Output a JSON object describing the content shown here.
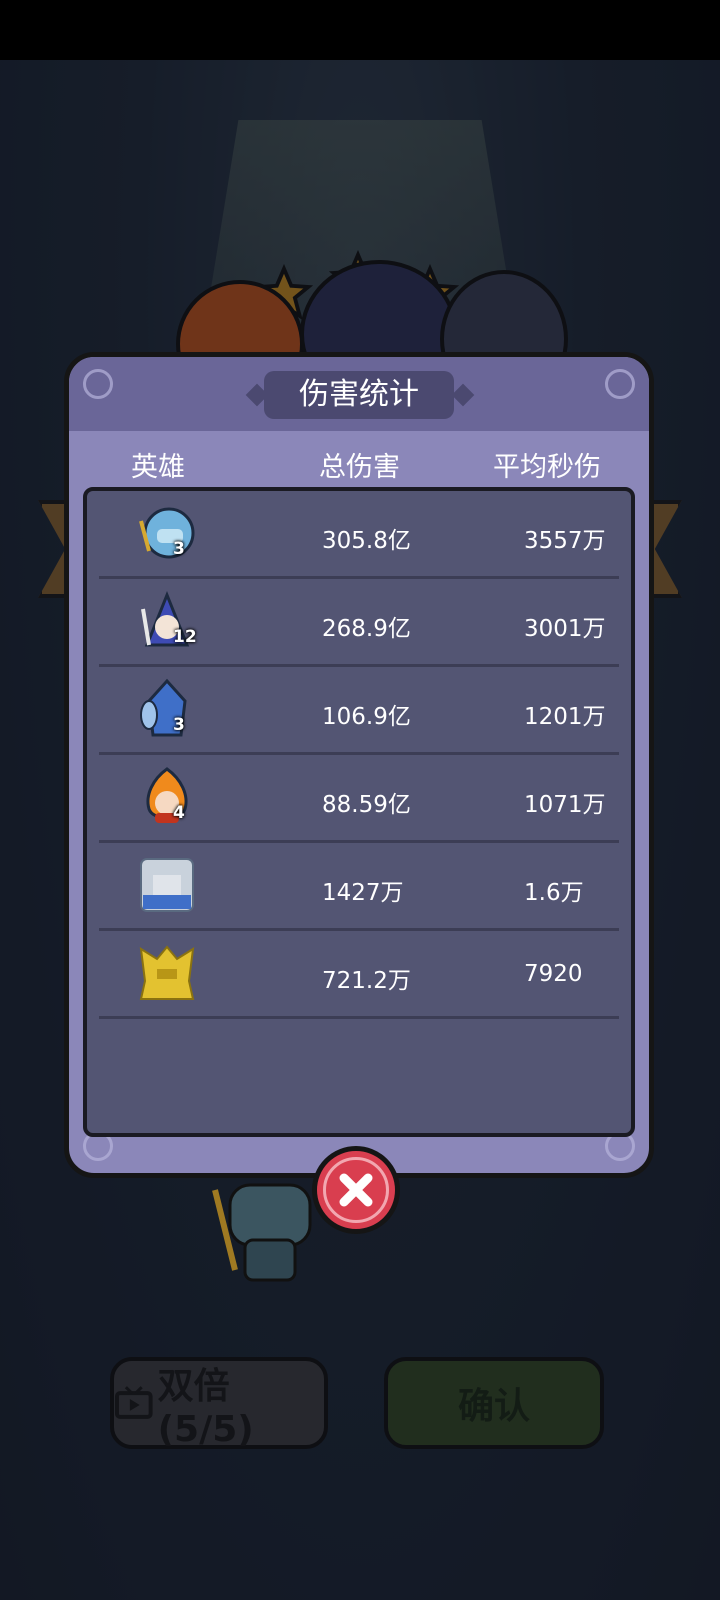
{
  "dialog": {
    "title": "伤害统计",
    "columns": {
      "hero": "英雄",
      "total_damage": "总伤害",
      "avg_dps": "平均秒伤"
    },
    "rows": [
      {
        "hero_icon": "blue-mage-hero-icon",
        "level": "3",
        "total_damage": "305.8亿",
        "avg_dps": "3557万"
      },
      {
        "hero_icon": "hooded-priest-hero-icon",
        "level": "12",
        "total_damage": "268.9亿",
        "avg_dps": "3001万"
      },
      {
        "hero_icon": "armored-knight-hero-icon",
        "level": "3",
        "total_damage": "106.9亿",
        "avg_dps": "1201万"
      },
      {
        "hero_icon": "fire-spirit-hero-icon",
        "level": "4",
        "total_damage": "88.59亿",
        "avg_dps": "1071万"
      },
      {
        "hero_icon": "silver-paladin-hero-icon",
        "level": "",
        "total_damage": "1427万",
        "avg_dps": "1.6万"
      },
      {
        "hero_icon": "golden-beast-hero-icon",
        "level": "",
        "total_damage": "721.2万",
        "avg_dps": "7920"
      }
    ]
  },
  "background": {
    "stars_earned": 3,
    "double_button_label": "双倍(5/5)",
    "confirm_button_label": "确认"
  },
  "colors": {
    "dialog_body": "#8b87b9",
    "table_bg": "#535573",
    "close_button": "#d93e4f",
    "star": "#e6a623"
  }
}
